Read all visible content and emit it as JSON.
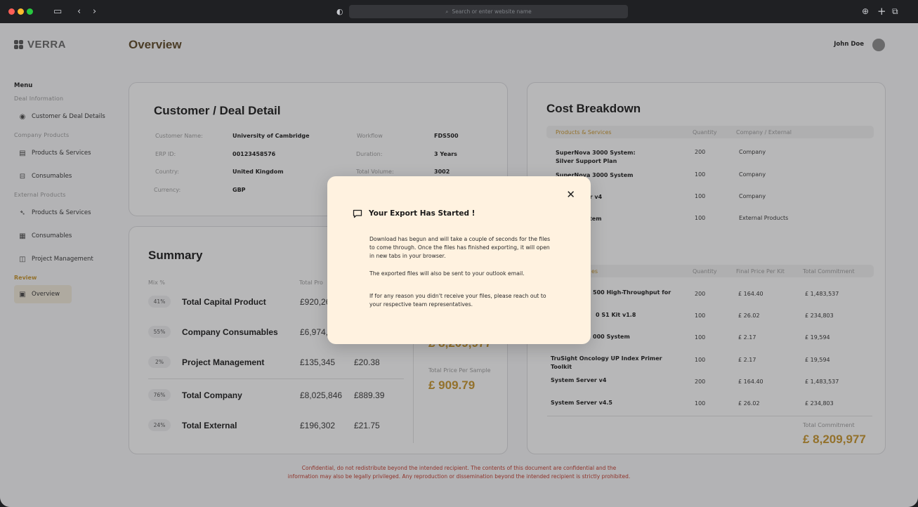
{
  "browser": {
    "url_placeholder": "Search or enter website name"
  },
  "app": {
    "logo_text": "VERRA",
    "page_title": "Overview",
    "user_name": "John Doe"
  },
  "sidebar": {
    "menu_heading": "Menu",
    "sections": {
      "deal_information": "Deal Information",
      "company_products": "Company Products",
      "external_products": "External Products",
      "review": "Review"
    },
    "items": {
      "customer_deal": "Customer & Deal Details",
      "company_products_services": "Products & Services",
      "company_consumables": "Consumables",
      "external_products_services": "Products & Services",
      "external_consumables": "Consumables",
      "project_management": "Project Management",
      "overview": "Overview"
    }
  },
  "deal": {
    "title": "Customer / Deal Detail",
    "fields": {
      "customer_name_label": "Customer Name:",
      "customer_name": "University of Cambridge",
      "erp_label": "ERP ID:",
      "erp": "00123458576",
      "country_label": "Country:",
      "country": "United Kingdom",
      "currency_label": "Currency:",
      "currency": "GBP",
      "workflow_label": "Workflow",
      "workflow": "FDS500",
      "duration_label": "Duration:",
      "duration": "3 Years",
      "volume_label": "Total Volume:",
      "volume": "3002"
    }
  },
  "summary": {
    "title": "Summary",
    "mix_header": "Mix %",
    "total_header": "Total Pro",
    "rows": [
      {
        "pct": "41%",
        "label": "Total Capital Product",
        "total": "£920,26",
        "per": ""
      },
      {
        "pct": "55%",
        "label": "Company Consumables",
        "total": "£6,974,",
        "per": ""
      },
      {
        "pct": "2%",
        "label": "Project Management",
        "total": "£135,345",
        "per": "£20.38"
      },
      {
        "pct": "76%",
        "label": "Total Company",
        "total": "£8,025,846",
        "per": "£889.39"
      },
      {
        "pct": "24%",
        "label": "Total External",
        "total": "£196,302",
        "per": "£21.75"
      }
    ],
    "commitment_partial": "£ 8,209,977",
    "price_per_sample_label": "Total Price Per Sample",
    "price_per_sample": "£ 909.79"
  },
  "cost": {
    "title": "Cost Breakdown",
    "table1_headers": {
      "products": "Products & Services",
      "quantity": "Quantity",
      "company": "Company / External"
    },
    "table1_rows": [
      {
        "name": "SuperNova 3000 System: Silver Support Plan",
        "qty": "200",
        "type": "Company"
      },
      {
        "name": "SuperNova 3000 System",
        "qty": "100",
        "type": "Company"
      },
      {
        "name": "ver v4",
        "qty": "100",
        "type": "Company"
      },
      {
        "name": "ystem",
        "qty": "100",
        "type": "External Products"
      }
    ],
    "table2_headers": {
      "products": "es",
      "quantity": "Quantity",
      "final_price": "Final Price Per Kit",
      "commitment": "Total Commitment"
    },
    "table2_rows": [
      {
        "name": "500 High-Throughput for",
        "qty": "200",
        "price": "£ 164.40",
        "total": "£ 1,483,537"
      },
      {
        "name": "0 S1 Kit v1.8",
        "qty": "100",
        "price": "£ 26.02",
        "total": "£ 234,803"
      },
      {
        "name": "000 System",
        "qty": "100",
        "price": "£ 2.17",
        "total": "£ 19,594"
      },
      {
        "name": "TruSight Oncology UP Index Primer Toolkit",
        "qty": "100",
        "price": "£ 2.17",
        "total": "£ 19,594"
      },
      {
        "name": "System Server v4",
        "qty": "200",
        "price": "£ 164.40",
        "total": "£ 1,483,537"
      },
      {
        "name": "System Server v4.5",
        "qty": "100",
        "price": "£ 26.02",
        "total": "£ 234,803"
      }
    ],
    "total_label": "Total Commitment",
    "total_value": "£ 8,209,977"
  },
  "footer": {
    "line1": "Confidential, do not redistribute beyond the intended recipient. The contents of this document are confidential and the",
    "line2": "information may also be legally privileged. Any reproduction or dissemination beyond the intended recipient is strictly prohibited."
  },
  "modal": {
    "title": "Your Export Has Started !",
    "p1": "Download has begun and will take a couple of seconds for the files to come through. Once the files has finished exporting, it will open in new tabs in your browser.",
    "p2": "The exported files will also be sent to your outlook email.",
    "p3": "If for any reason you didn't receive your files, please reach out to your respective team representatives.",
    "close_icon": "close-icon",
    "message_icon": "message-icon"
  },
  "colors": {
    "accent": "#c6942c",
    "brand_title": "#5c4726",
    "modal_bg": "#fff2e0",
    "footer_text": "#c0392b"
  }
}
